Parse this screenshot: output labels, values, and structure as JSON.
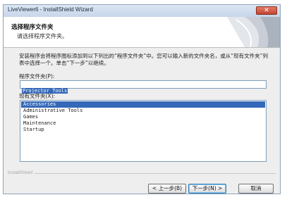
{
  "window": {
    "title": "LiveViewer6 - InstallShield Wizard",
    "close_label": "✕"
  },
  "header": {
    "title": "选择程序文件夹",
    "subtitle": "请选择程序文件夹。"
  },
  "description": "安装程序会将程序图标添加到以下列出的“程序文件夹”中。您可以输入新的文件夹名，或从“现有文件夹”列表中选择一个。单击“下一步”以继续。",
  "program_folder": {
    "label": "程序文件夹(P):",
    "value": "Projector Tools"
  },
  "existing_folders": {
    "label": "现有文件夹(X):",
    "items": [
      "Accessories",
      "Administrative Tools",
      "Games",
      "Maintenance",
      "Startup"
    ],
    "selected_index": 0
  },
  "footer": {
    "brand": "InstallShield"
  },
  "buttons": {
    "back": "< 上一步(B)",
    "next": "下一步(N) >",
    "cancel": "取消"
  },
  "colors": {
    "selection": "#3468b8",
    "titlebar": "#c6d6ea",
    "close": "#c2452f"
  }
}
